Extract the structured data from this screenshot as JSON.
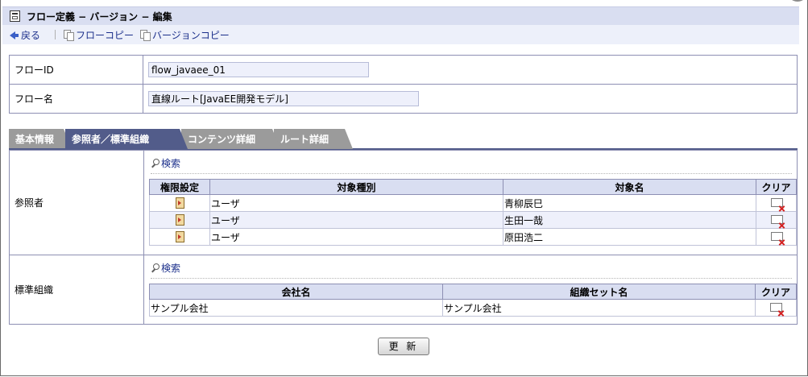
{
  "titlebar": {
    "title": "フロー定義 − バージョン − 編集"
  },
  "toolbar": {
    "back_label": "戻る",
    "flow_copy_label": "フローコピー",
    "version_copy_label": "バージョンコピー"
  },
  "info": {
    "flow_id_label": "フローID",
    "flow_id_value": "flow_javaee_01",
    "flow_name_label": "フロー名",
    "flow_name_value": "直線ルート[JavaEE開発モデル]"
  },
  "tabs": [
    {
      "label": "基本情報",
      "active": false
    },
    {
      "label": "参照者／標準組織",
      "active": true
    },
    {
      "label": "コンテンツ詳細",
      "active": false
    },
    {
      "label": "ルート詳細",
      "active": false
    }
  ],
  "referrers": {
    "label": "参照者",
    "search_label": "検索",
    "headers": [
      "権限設定",
      "対象種別",
      "対象名",
      "クリア"
    ],
    "rows": [
      {
        "type": "ユーザ",
        "name": "青柳辰巳"
      },
      {
        "type": "ユーザ",
        "name": "生田一哉"
      },
      {
        "type": "ユーザ",
        "name": "原田浩二"
      }
    ]
  },
  "standard_org": {
    "label": "標準組織",
    "search_label": "検索",
    "headers": [
      "会社名",
      "組織セット名",
      "クリア"
    ],
    "rows": [
      {
        "company": "サンプル会社",
        "org_set": "サンプル会社"
      }
    ]
  },
  "update_button": "更 新",
  "icons": [
    "doc-icon",
    "back-arrow-icon",
    "copy-icon",
    "search-icon",
    "permission-icon",
    "clear-icon"
  ]
}
